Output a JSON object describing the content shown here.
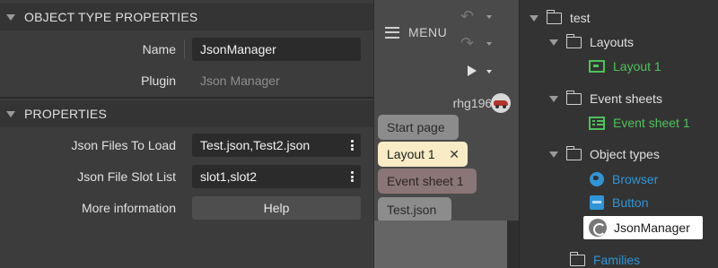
{
  "properties": {
    "object_type_header": "OBJECT TYPE PROPERTIES",
    "name_label": "Name",
    "name_value": "JsonManager",
    "plugin_label": "Plugin",
    "plugin_value": "Json Manager",
    "properties_header": "PROPERTIES",
    "json_files_label": "Json Files To Load",
    "json_files_value": "Json Files To Load",
    "json_files_value_text": "Test.json,Test2.json",
    "slot_list_label": "Json File Slot List",
    "slot_list_value": "slot1,slot2",
    "more_info_label": "More information",
    "help_button_label": "Help"
  },
  "toolbar": {
    "menu_label": "MENU",
    "username": "rhg1968",
    "tabs": [
      {
        "label": "Start page"
      },
      {
        "label": "Layout 1",
        "close": "✕"
      },
      {
        "label": "Event sheet 1"
      },
      {
        "label": "Test.json"
      }
    ],
    "icons": [
      "undo-icon",
      "redo-icon",
      "play-icon"
    ]
  },
  "tree": {
    "root": "test",
    "layouts_folder": "Layouts",
    "layout_item": "Layout 1",
    "eventsheets_folder": "Event sheets",
    "eventsheet_item": "Event sheet 1",
    "objecttypes_folder": "Object types",
    "browser_item": "Browser",
    "button_item": "Button",
    "jsonmanager_item": "JsonManager",
    "families_folder": "Families"
  },
  "colors": {
    "panel_bg": "#3c3c3c",
    "tree_bg": "#333333",
    "green": "#4ec25a",
    "blue": "#2f95d6",
    "active_tab": "#f8ecc6"
  }
}
